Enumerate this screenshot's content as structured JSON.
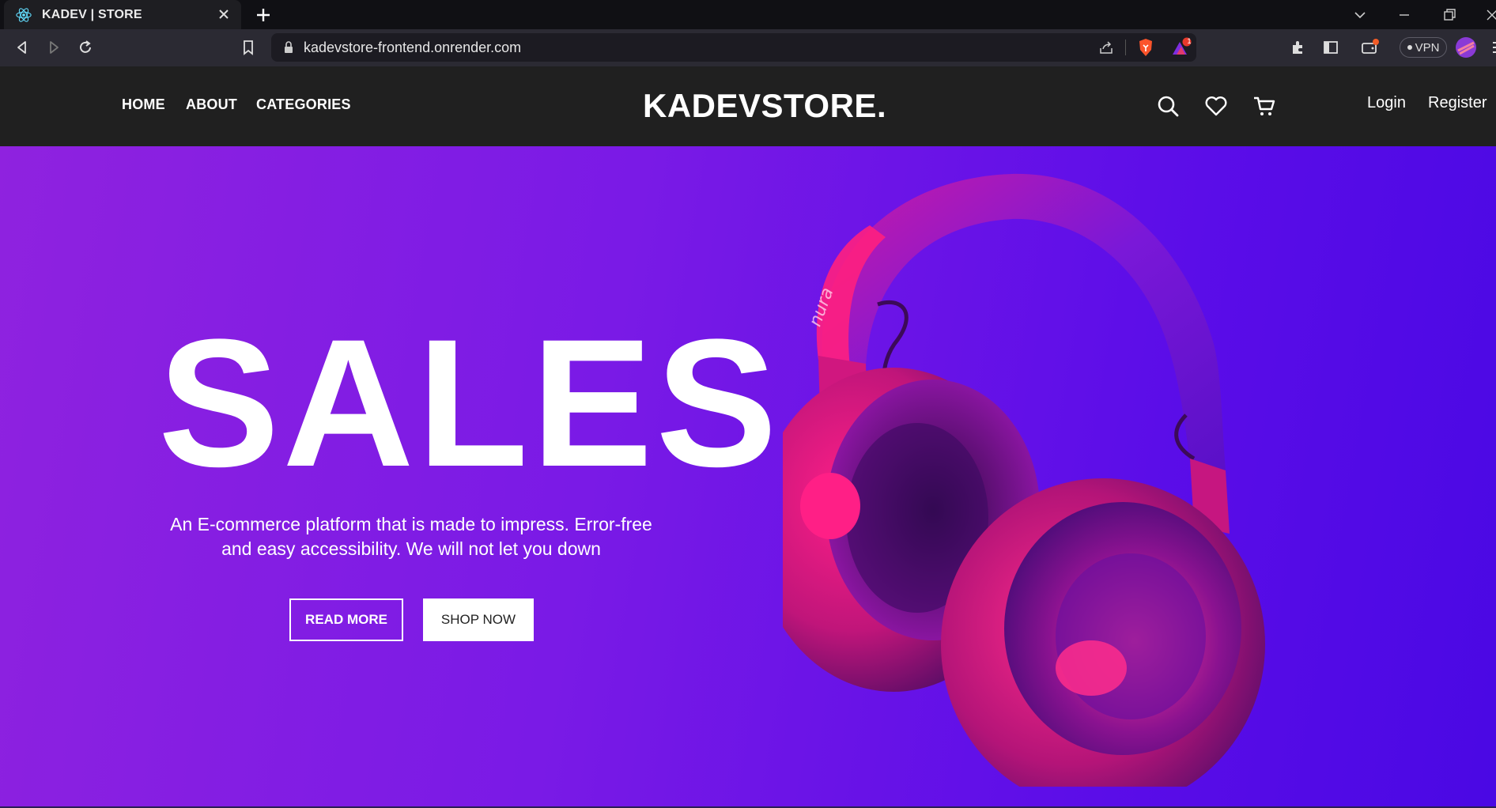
{
  "browser": {
    "tab_title": "KADEV | STORE",
    "url": "kadevstore-frontend.onrender.com",
    "vpn_label": "VPN",
    "notification_count": "1"
  },
  "header": {
    "nav": [
      "HOME",
      "ABOUT",
      "CATEGORIES"
    ],
    "logo": "KADEVSTORE.",
    "login": "Login",
    "register": "Register"
  },
  "hero": {
    "title": "SALES",
    "description": "An E-commerce platform that is made to impress. Error-free and easy accessibility. We will not let you down",
    "read_more": "READ MORE",
    "shop_now": "SHOP NOW",
    "product_brand": "nura"
  },
  "colors": {
    "header_bg": "#202020",
    "hero_gradient_start": "#8f22df",
    "hero_gradient_end": "#4a08e4",
    "headphone_pink": "#e8197a",
    "headphone_purple": "#7a14d8"
  }
}
